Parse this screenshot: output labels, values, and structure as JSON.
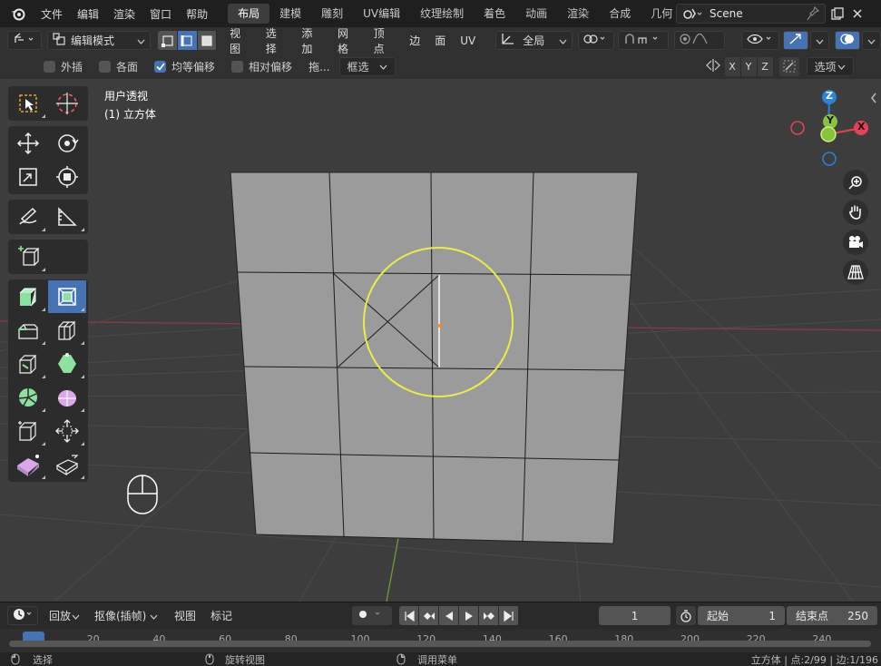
{
  "top_menu": {
    "items": [
      "文件",
      "编辑",
      "渲染",
      "窗口",
      "帮助"
    ]
  },
  "workspace_tabs": [
    "布局",
    "建模",
    "雕刻",
    "UV编辑",
    "纹理绘制",
    "着色",
    "动画",
    "渲染",
    "合成",
    "几何"
  ],
  "active_tab_index": 0,
  "scene": {
    "name": "Scene"
  },
  "viewport_header": {
    "mode": "编辑模式",
    "menus": [
      "视图",
      "选择",
      "添加",
      "网格",
      "顶点",
      "边",
      "面",
      "UV"
    ],
    "transform_orientation": "全局"
  },
  "options_row": {
    "checkboxes": [
      {
        "label": "外插",
        "checked": false
      },
      {
        "label": "各面",
        "checked": false
      },
      {
        "label": "均等偏移",
        "checked": true
      },
      {
        "label": "相对偏移",
        "checked": false
      }
    ],
    "drag_label": "拖...",
    "select_box": "框选",
    "axes": [
      "X",
      "Y",
      "Z"
    ],
    "options_label": "选项"
  },
  "viewport": {
    "view_label": "用户透视",
    "object_label": "(1) 立方体"
  },
  "gizmo": {
    "labels": [
      "Z",
      "Y",
      "X"
    ],
    "colors": {
      "x": "#e84057",
      "y": "#8ac43f",
      "z": "#2b82d9"
    }
  },
  "timeline": {
    "playback": "回放",
    "keying": "抠像(插帧)",
    "view": "视图",
    "marker": "标记",
    "current_frame": "1",
    "start_label": "起始",
    "start_value": "1",
    "end_label": "结束点",
    "end_value": "250",
    "ruler_ticks": [
      "1",
      "20",
      "40",
      "60",
      "80",
      "100",
      "120",
      "140",
      "160",
      "180",
      "200",
      "220",
      "240"
    ]
  },
  "statusbar": {
    "select": "选择",
    "rotate": "旋转视图",
    "menu": "调用菜单",
    "stats": "立方体 | 点:2/99 | 边:1/196"
  }
}
